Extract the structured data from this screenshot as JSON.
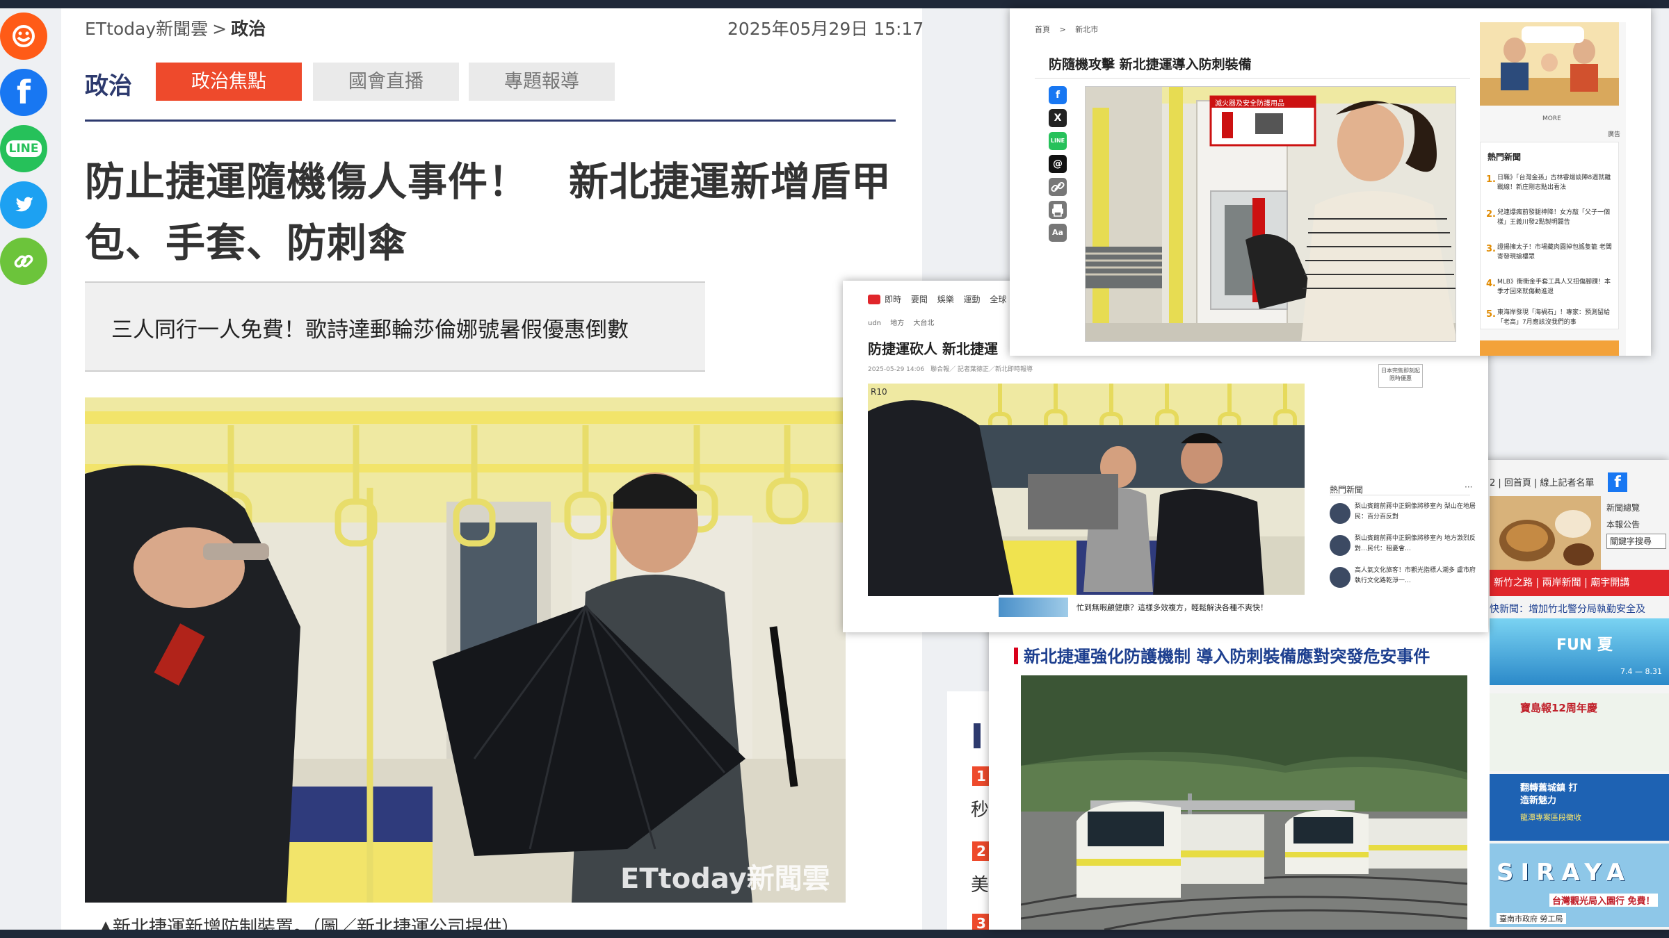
{
  "ettoday": {
    "breadcrumb": {
      "site": "ETtoday新聞雲",
      "separator": ">",
      "category": "政治"
    },
    "datetime": "2025年05月29日 15:17",
    "section_title": "政治",
    "tabs": [
      {
        "label": "政治焦點",
        "active": true
      },
      {
        "label": "國會直播",
        "active": false
      },
      {
        "label": "專題報導",
        "active": false
      }
    ],
    "headline_line1": "防止捷運隨機傷人事件！　新北捷運新增盾甲",
    "headline_line2": "包、手套、防刺傘",
    "promo_text": "三人同行一人免費！歌詩達郵輪莎倫娜號暑假優惠倒數",
    "watermark": "ETtoday新聞雲",
    "caption": "▲新北捷運新增防制裝置。（圖／新北捷運公司提供）",
    "share": [
      "plurk-icon",
      "facebook-icon",
      "line-icon",
      "twitter-icon",
      "link-icon"
    ],
    "line_label": "LINE",
    "facebook_glyph": "f",
    "rank_numbers": [
      "1",
      "2",
      "3"
    ],
    "rank_chars": [
      "秒",
      "美"
    ],
    "colors": {
      "accent": "#ee4a2c",
      "navy": "#2d3a6e"
    }
  },
  "udn": {
    "nav": [
      "即時",
      "要聞",
      "娛樂",
      "運動",
      "全球"
    ],
    "crumb": [
      "udn",
      "地方",
      "大台北"
    ],
    "headline": "防捷運砍人 新北捷運",
    "meta": "2025-05-29 14:06　聯合報／ 記者葉德正／新北即時報導",
    "ad_box": "日本完售即刻起限時優惠",
    "photo_tag": "R10",
    "hot_title": "熱門新聞",
    "hot_more": "···",
    "hot_items": [
      "梨山賓館前蔣中正銅像將移室內 梨山在地居民：百分百反對",
      "梨山賓館前蔣中正銅像將移室內 地方激烈反對…民代：租憂會…",
      "高人氣文化旅客！市觀光指標人潮多 盧市府執行文化路乾淨一…"
    ],
    "banner_text": "忙到無暇顧健康？這樣多效複方，輕鬆解決各種不爽快！"
  },
  "yahoo": {
    "topnav": "2 | 回首頁 | 線上記者名單",
    "fb_glyph": "f",
    "news_link_1": "新聞總覽",
    "news_link_2": "本報公告",
    "search_placeholder": "關鍵字搜尋",
    "red_bar": "新竹之路 | 兩岸新聞 | 廟宇開講",
    "ticker": "快新聞：增加竹北警分局執勤安全及",
    "title": "新北捷運強化防護機制 導入防刺裝備應對突發危安事件",
    "ad1_text": "FUN 夏",
    "ad1_sub": "7.4 — 8.31",
    "ad2_text": "寶島報12周年慶",
    "ad3_text": "翻轉舊城鎮 打造新魅力",
    "ad3_sub": "龍潭專案區段徵收",
    "ad4_text": "SIRAYA",
    "ad4_sub": "台灣觀光局入園行 免費！",
    "ad4_foot": "臺南市政府 勞工局"
  },
  "topright": {
    "crumb": [
      "首頁",
      ">",
      "新北市"
    ],
    "headline": "防隨機攻擊 新北捷運導入防刺裝備",
    "share_icons": [
      "facebook-icon",
      "x-icon",
      "line-icon",
      "threads-icon",
      "link-icon",
      "print-icon",
      "font-size-icon"
    ],
    "icon_glyphs": {
      "facebook": "f",
      "x": "X",
      "line": "LINE",
      "threads": "@",
      "font": "Aa"
    },
    "cabinet_label": "滅火器及安全防護用品",
    "more": "MORE",
    "ad_tag": "廣告",
    "hot_title": "熱門新聞",
    "hot_items": [
      {
        "n": "1.",
        "t": "日職》「台灣金孫」古林睿煬談陣8週就離戰線！新庄剛志點出看法"
      },
      {
        "n": "2.",
        "t": "兒連爆瘋前發腿神降！女方敲「父子一個樣」王義川發2點製明闢告"
      },
      {
        "n": "3.",
        "t": "證揚擁太子！市場藏肉圓掉包謠隻籠 老闆寄發現搶樓眾"
      },
      {
        "n": "4.",
        "t": "MLB》衝衝金手套工具人又扭傷腳踝！本季才回來就傷動進退"
      },
      {
        "n": "5.",
        "t": "東海岸發現「海禍石」！專家：預測留給「老高」7月應該沒我們的事"
      }
    ]
  }
}
